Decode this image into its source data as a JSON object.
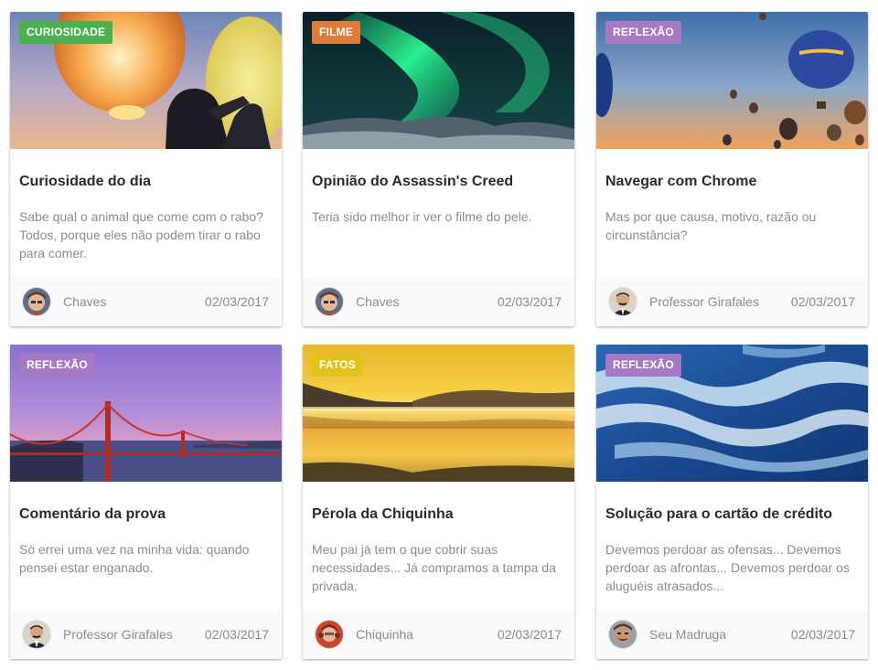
{
  "colors": {
    "curiosidade": "#4caf50",
    "filme": "#e07b39",
    "reflexao": "#a779c4",
    "fatos": "#e2c21d"
  },
  "cards": [
    {
      "category": "CURIOSIDADE",
      "category_color": "#4caf50",
      "image": "sky-lanterns-image",
      "title": "Curiosidade do dia",
      "text": "Sabe qual o animal que come com o rabo? Todos, porque eles não podem tirar o rabo para comer.",
      "author": "Chaves",
      "date": "02/03/2017"
    },
    {
      "category": "FILME",
      "category_color": "#e07b39",
      "image": "aurora-image",
      "title": "Opinião do Assassin's Creed",
      "text": "Teria sido melhor ir ver o filme do pele.",
      "author": "Chaves",
      "date": "02/03/2017"
    },
    {
      "category": "REFLEXÃO",
      "category_color": "#a779c4",
      "image": "hot-air-balloons-image",
      "title": "Navegar com Chrome",
      "text": "Mas por que causa, motivo, razão ou circunstância?",
      "author": "Professor Girafales",
      "date": "02/03/2017"
    },
    {
      "category": "REFLEXÃO",
      "category_color": "#a779c4",
      "image": "golden-gate-bridge-image",
      "title": "Comentário da prova",
      "text": "Só errei uma vez na minha vida: quando pensei estar enganado.",
      "author": "Professor Girafales",
      "date": "02/03/2017"
    },
    {
      "category": "FATOS",
      "category_color": "#e2c21d",
      "image": "lake-sunset-image",
      "title": "Pérola da Chiquinha",
      "text": "Meu pai já tem o que cobrir suas necessidades... Já compramos a tampa da privada.",
      "author": "Chiquinha",
      "date": "02/03/2017"
    },
    {
      "category": "REFLEXÃO",
      "category_color": "#a779c4",
      "image": "ocean-waves-image",
      "title": "Solução para o cartão de crédito",
      "text": "Devemos perdoar as ofensas... Devemos perdoar as afrontas... Devemos perdoar os aluguéis atrasados...",
      "author": "Seu Madruga",
      "date": "02/03/2017"
    }
  ]
}
